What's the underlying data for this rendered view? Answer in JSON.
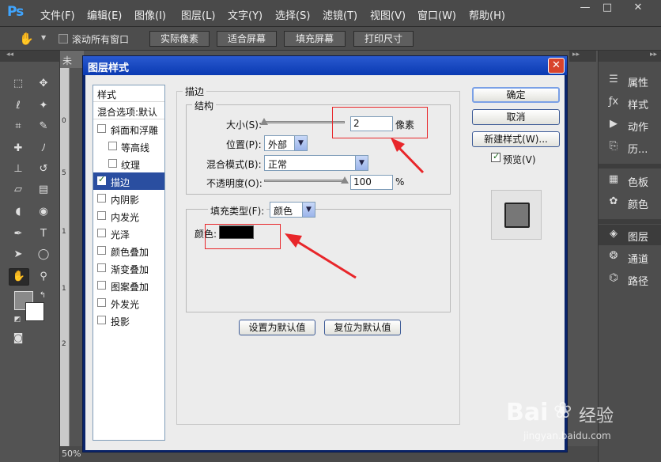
{
  "app": {
    "logo": "Ps",
    "menus": [
      "文件(F)",
      "编辑(E)",
      "图像(I)",
      "图层(L)",
      "文字(Y)",
      "选择(S)",
      "滤镜(T)",
      "视图(V)",
      "窗口(W)",
      "帮助(H)"
    ],
    "window_controls": [
      "—",
      "□",
      "✕"
    ]
  },
  "options_bar": {
    "scroll_all_label": "滚动所有窗口",
    "buttons": [
      "实际像素",
      "适合屏幕",
      "填充屏幕",
      "打印尺寸"
    ]
  },
  "document": {
    "tab_label": "未",
    "zoom": "50%",
    "ruler_marks": [
      "0",
      "5",
      "1",
      "1",
      "2"
    ]
  },
  "right_panel": {
    "items": [
      {
        "label": "属性",
        "icon": "properties-icon"
      },
      {
        "label": "样式",
        "icon": "styles-icon"
      },
      {
        "label": "动作",
        "icon": "actions-icon"
      },
      {
        "label": "历...",
        "icon": "history-icon"
      },
      {
        "label": "色板",
        "icon": "swatches-icon"
      },
      {
        "label": "颜色",
        "icon": "color-icon"
      },
      {
        "label": "图层",
        "icon": "layers-icon"
      },
      {
        "label": "通道",
        "icon": "channels-icon"
      },
      {
        "label": "路径",
        "icon": "paths-icon"
      }
    ]
  },
  "dialog": {
    "title": "图层样式",
    "styles_header": "样式",
    "blend_options": "混合选项:默认",
    "style_items": [
      {
        "label": "斜面和浮雕",
        "checked": false
      },
      {
        "label": "等高线",
        "checked": false
      },
      {
        "label": "纹理",
        "checked": false
      },
      {
        "label": "描边",
        "checked": true
      },
      {
        "label": "内阴影",
        "checked": false
      },
      {
        "label": "内发光",
        "checked": false
      },
      {
        "label": "光泽",
        "checked": false
      },
      {
        "label": "颜色叠加",
        "checked": false
      },
      {
        "label": "渐变叠加",
        "checked": false
      },
      {
        "label": "图案叠加",
        "checked": false
      },
      {
        "label": "外发光",
        "checked": false
      },
      {
        "label": "投影",
        "checked": false
      }
    ],
    "section_title": "描边",
    "structure_title": "结构",
    "size_label": "大小(S):",
    "size_value": "2",
    "size_unit": "像素",
    "size_level": 0,
    "position_label": "位置(P):",
    "position_value": "外部",
    "blend_mode_label": "混合模式(B):",
    "blend_mode_value": "正常",
    "opacity_label": "不透明度(O):",
    "opacity_value": "100",
    "opacity_unit": "%",
    "opacity_level": 1.0,
    "fill_type_label": "填充类型(F):",
    "fill_type_value": "颜色",
    "color_label": "颜色:",
    "color_value": "#000000",
    "set_default": "设置为默认值",
    "reset_default": "复位为默认值",
    "ok": "确定",
    "cancel": "取消",
    "new_style": "新建样式(W)...",
    "preview_label": "预览(V)",
    "preview_checked": true
  },
  "annotations": {
    "accent": "#e8262a"
  },
  "watermark": {
    "brand": "Bai",
    "brand2": "经验",
    "url": "jingyan.baidu.com"
  }
}
